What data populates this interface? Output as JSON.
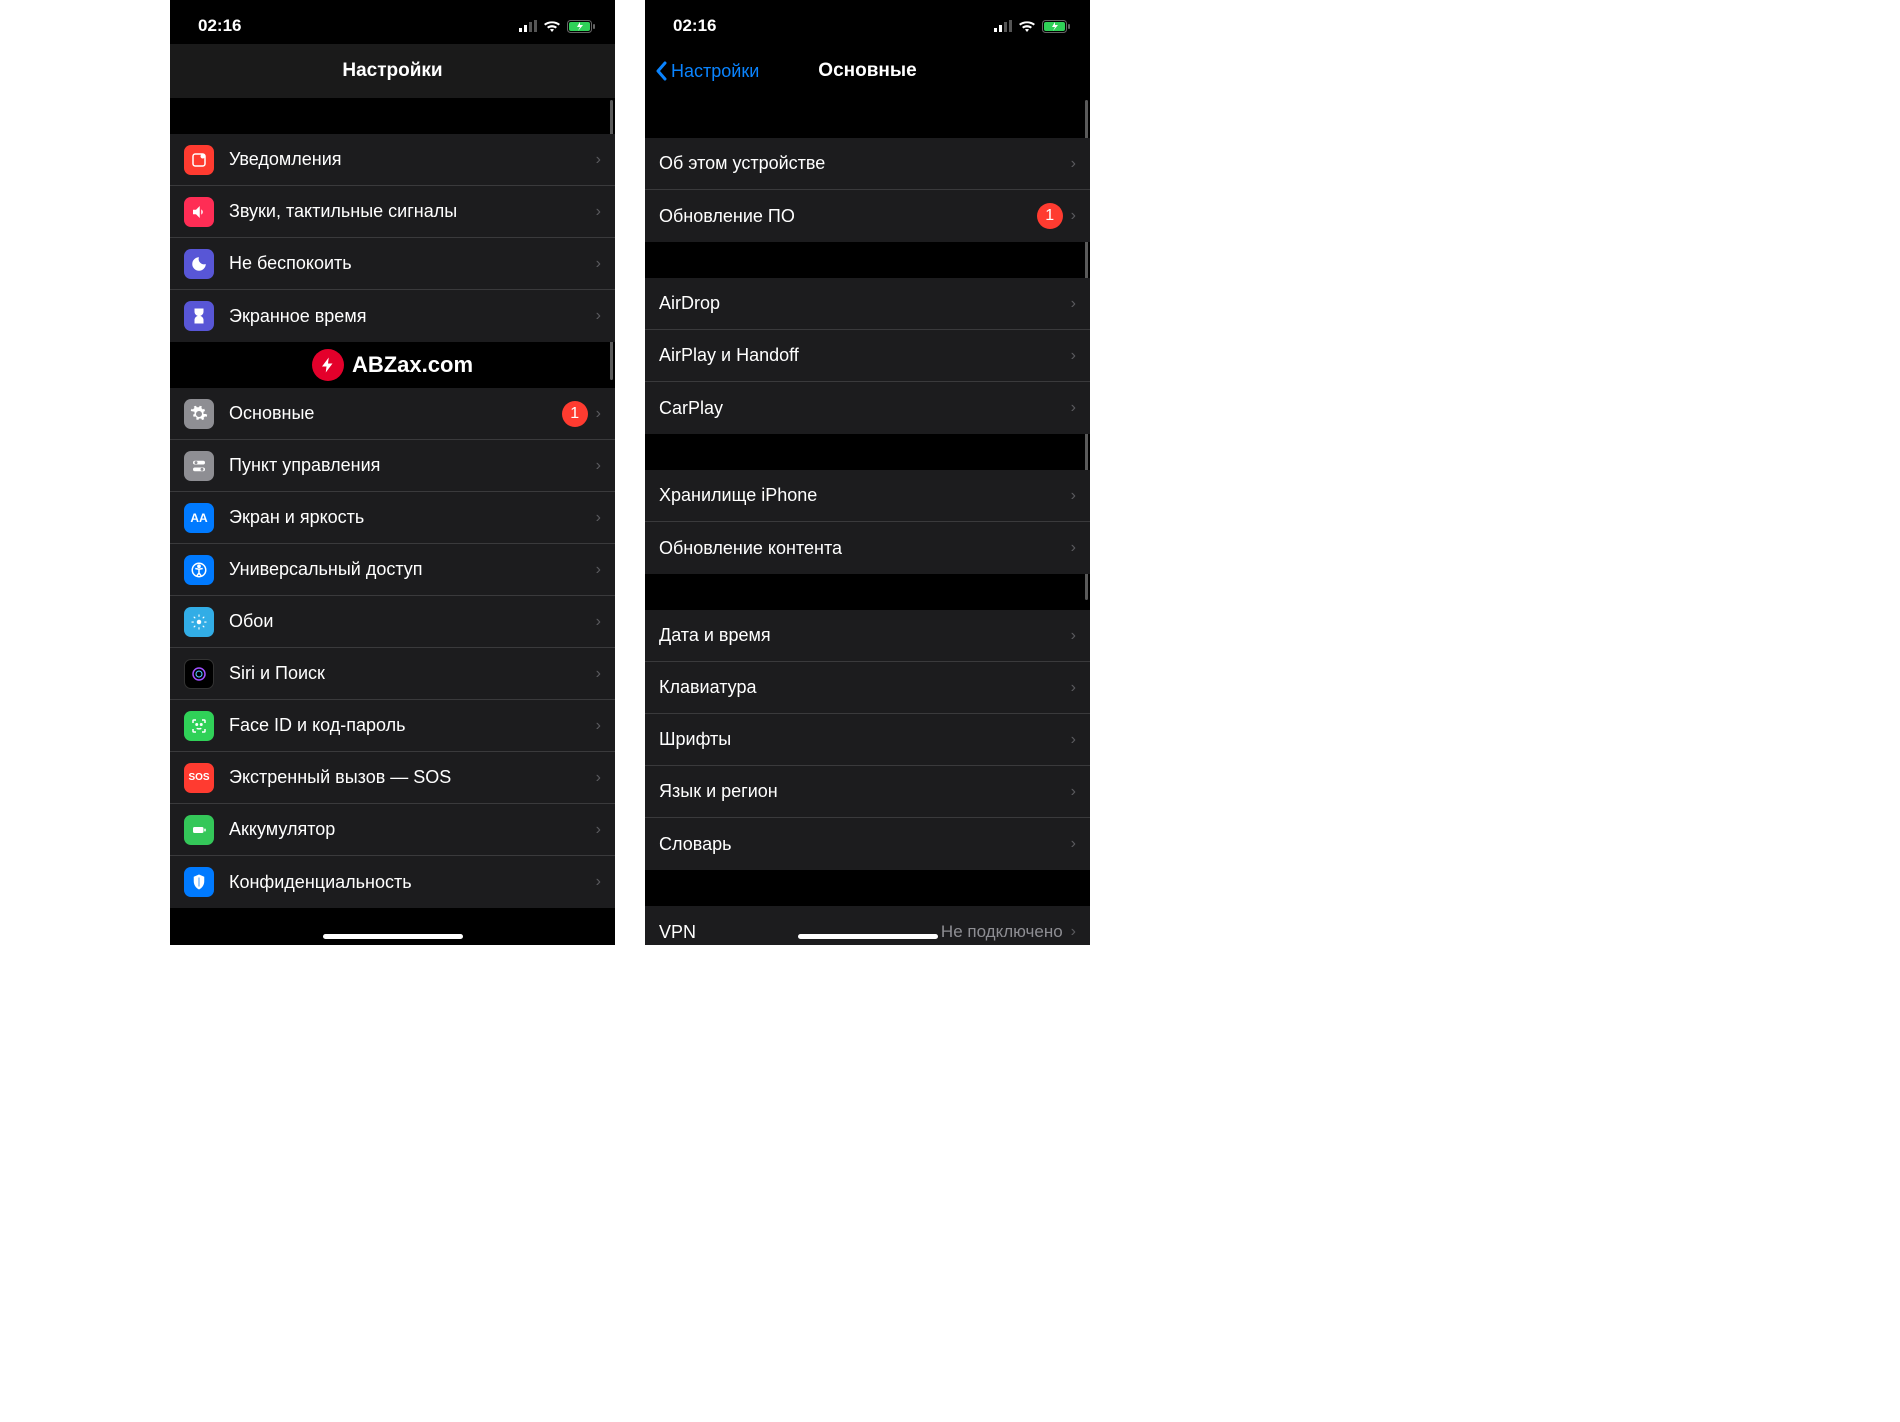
{
  "status": {
    "time": "02:16"
  },
  "watermark": "ABZax.com",
  "left": {
    "title": "Настройки",
    "groups": [
      {
        "rows": [
          {
            "label": "Уведомления",
            "icon": "notifications-icon",
            "color": "ic-red"
          },
          {
            "label": "Звуки, тактильные сигналы",
            "icon": "sounds-icon",
            "color": "ic-pink"
          },
          {
            "label": "Не беспокоить",
            "icon": "dnd-icon",
            "color": "ic-purple"
          },
          {
            "label": "Экранное время",
            "icon": "screentime-icon",
            "color": "ic-purple2"
          }
        ]
      },
      {
        "rows": [
          {
            "label": "Основные",
            "icon": "general-icon",
            "color": "ic-gray",
            "badge": "1"
          },
          {
            "label": "Пункт управления",
            "icon": "control-center-icon",
            "color": "ic-gray2"
          },
          {
            "label": "Экран и яркость",
            "icon": "display-icon",
            "color": "ic-blue"
          },
          {
            "label": "Универсальный доступ",
            "icon": "accessibility-icon",
            "color": "ic-blue2"
          },
          {
            "label": "Обои",
            "icon": "wallpaper-icon",
            "color": "ic-teal"
          },
          {
            "label": "Siri и Поиск",
            "icon": "siri-icon",
            "color": "ic-black"
          },
          {
            "label": "Face ID и код-пароль",
            "icon": "faceid-icon",
            "color": "ic-green"
          },
          {
            "label": "Экстренный вызов — SOS",
            "icon": "sos-icon",
            "color": "ic-sos",
            "text_icon": "SOS"
          },
          {
            "label": "Аккумулятор",
            "icon": "battery-icon",
            "color": "ic-batt"
          },
          {
            "label": "Конфиденциальность",
            "icon": "privacy-icon",
            "color": "ic-priv"
          }
        ]
      }
    ]
  },
  "right": {
    "back": "Настройки",
    "title": "Основные",
    "groups": [
      {
        "rows": [
          {
            "label": "Об этом устройстве"
          },
          {
            "label": "Обновление ПО",
            "badge": "1"
          }
        ]
      },
      {
        "rows": [
          {
            "label": "AirDrop"
          },
          {
            "label": "AirPlay и Handoff"
          },
          {
            "label": "CarPlay"
          }
        ]
      },
      {
        "rows": [
          {
            "label": "Хранилище iPhone"
          },
          {
            "label": "Обновление контента"
          }
        ]
      },
      {
        "rows": [
          {
            "label": "Дата и время"
          },
          {
            "label": "Клавиатура"
          },
          {
            "label": "Шрифты"
          },
          {
            "label": "Язык и регион"
          },
          {
            "label": "Словарь"
          }
        ]
      },
      {
        "rows": [
          {
            "label": "VPN",
            "detail": "Не подключено"
          }
        ]
      }
    ]
  }
}
